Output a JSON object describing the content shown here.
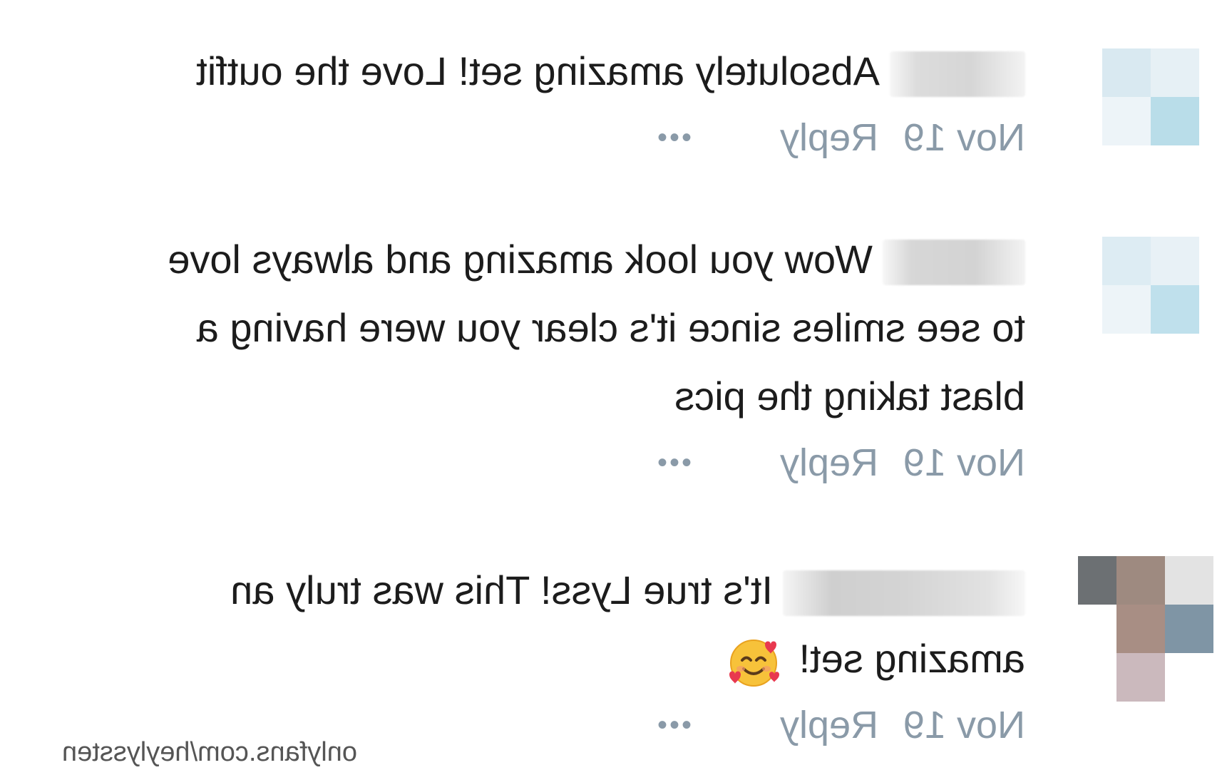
{
  "comments": [
    {
      "text_lines": [
        "Absolutely amazing set! Love the outfit"
      ],
      "date": "Nov 19",
      "reply_label": "Reply",
      "more_label": "•••",
      "avatar_colors": [
        "#d7e8f0",
        "#e4eff5",
        "#b9dde9",
        "#eef5f8"
      ]
    },
    {
      "text_lines": [
        "Wow you look amazing and always love",
        "to see smiles since it's clear you were having a",
        "blast taking the pics"
      ],
      "date": "Nov 19",
      "reply_label": "Reply",
      "more_label": "•••",
      "avatar_colors": [
        "#dcebf2",
        "#e6f1f6",
        "#bfe0ec",
        "#eef5f8"
      ]
    },
    {
      "text_lines": [
        "It's true Lyss! This was truly an",
        "amazing set!"
      ],
      "emoji": "smiling-face-with-hearts-icon",
      "date": "Nov 19",
      "reply_label": "Reply",
      "more_label": "•••",
      "avatar_colors": [
        "#6c7073",
        "#a88e84",
        "#7f95a5",
        "#cbb9bd",
        "#9e8a80"
      ]
    }
  ],
  "watermark": "onlyfans.com/heylyssten"
}
